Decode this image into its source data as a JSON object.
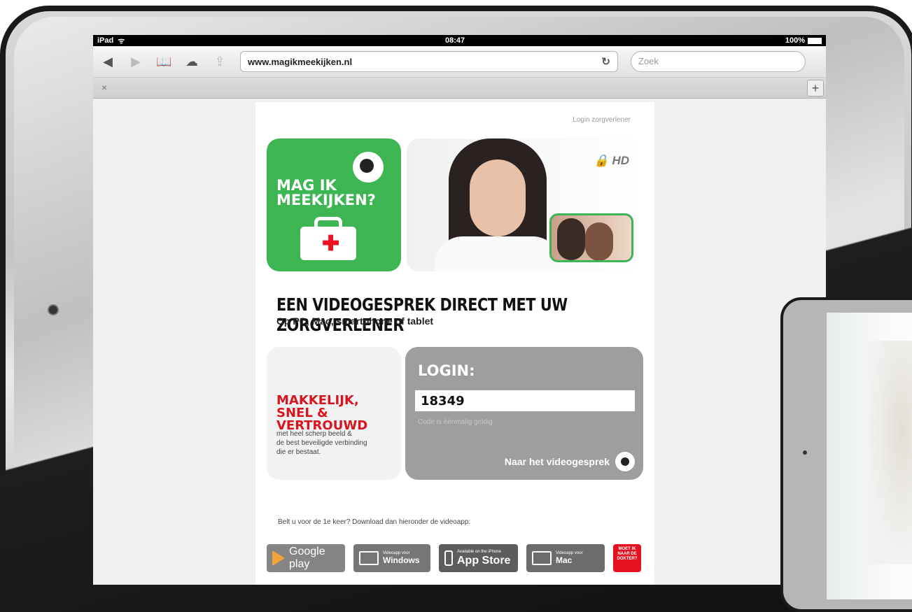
{
  "status": {
    "device": "iPad",
    "time": "08:47",
    "battery": "100%"
  },
  "browser": {
    "url": "www.magikmeekijken.nl",
    "search_placeholder": "Zoek",
    "tab_close": "×",
    "tab_add": "+"
  },
  "page": {
    "login_link": "Login zorgverlener",
    "logo_text": "MAG IK\nMEEKIJKEN?",
    "hd_label": "HD",
    "headline": "EEN VIDEOGESPREK DIRECT MET UW ZORGVERLENER",
    "subline": "Op PC, Mac, smartphone of tablet",
    "feature_title": "MAKKELIJK, SNEL & VERTROUWD",
    "feature_desc": "met heel scherp beeld &\nde best beveiligde verbinding\ndie er bestaat.",
    "login_label": "LOGIN:",
    "code_value": "18349",
    "code_hint": "Code is éénmalig geldig",
    "go_label": "Naar het videogesprek",
    "download_text": "Belt u voor de 1e keer? Download dan hieronder de videoapp:",
    "stores": {
      "google": "Google play",
      "windows_top": "Videoapp voor",
      "windows_main": "Windows",
      "apple_top": "Available on the iPhone",
      "apple_main": "App Store",
      "mac_top": "Videoapp voor",
      "mac_main": "Mac"
    },
    "badge": "MOET IK NAAR DE DOKTER?"
  },
  "colors": {
    "brand_green": "#3db552",
    "accent_red": "#d8141e",
    "login_gray": "#9e9e9e"
  }
}
